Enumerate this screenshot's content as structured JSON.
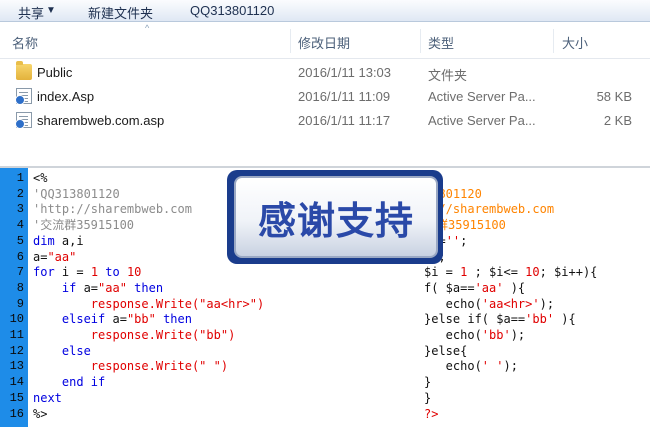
{
  "toolbar": {
    "share_label": "共享",
    "share_arrow": "▼",
    "new_folder_label": "新建文件夹",
    "qq_label": "QQ313801120"
  },
  "columns": {
    "sort_arrow": "^",
    "name": "名称",
    "date": "修改日期",
    "type": "类型",
    "size": "大小"
  },
  "files": [
    {
      "name": "Public",
      "date": "2016/1/11 13:03",
      "type": "文件夹",
      "size": "",
      "icon": "folder-icon"
    },
    {
      "name": "index.Asp",
      "date": "2016/1/11 11:09",
      "type": "Active Server Pa...",
      "size": "58 KB",
      "icon": "asp-file-icon"
    },
    {
      "name": "sharembweb.com.asp",
      "date": "2016/1/11 11:17",
      "type": "Active Server Pa...",
      "size": "2 KB",
      "icon": "asp-file-icon"
    }
  ],
  "asp_code": [
    {
      "n": "1",
      "segs": [
        [
          "<%",
          "c-black"
        ]
      ]
    },
    {
      "n": "2",
      "segs": [
        [
          "'QQ313801120",
          "c-gray"
        ]
      ]
    },
    {
      "n": "3",
      "segs": [
        [
          "'http://sharembweb.com",
          "c-gray"
        ]
      ]
    },
    {
      "n": "4",
      "segs": [
        [
          "'交流群35915100",
          "c-gray"
        ]
      ]
    },
    {
      "n": "5",
      "segs": [
        [
          "dim",
          "c-blue"
        ],
        [
          " a,i",
          "c-black"
        ]
      ]
    },
    {
      "n": "6",
      "segs": [
        [
          "a=",
          "c-black"
        ],
        [
          "\"aa\"",
          "c-red"
        ]
      ]
    },
    {
      "n": "7",
      "segs": [
        [
          "for",
          "c-blue"
        ],
        [
          " i = ",
          "c-black"
        ],
        [
          "1",
          "c-red"
        ],
        [
          " to ",
          "c-blue"
        ],
        [
          "10",
          "c-red"
        ]
      ]
    },
    {
      "n": "8",
      "segs": [
        [
          "    if",
          "c-blue"
        ],
        [
          " a=",
          "c-black"
        ],
        [
          "\"aa\"",
          "c-red"
        ],
        [
          " then",
          "c-blue"
        ]
      ]
    },
    {
      "n": "9",
      "segs": [
        [
          "        response.Write(",
          "c-red"
        ],
        [
          "\"aa<hr>\"",
          "c-red"
        ],
        [
          ")",
          "c-red"
        ]
      ]
    },
    {
      "n": "10",
      "segs": [
        [
          "    elseif",
          "c-blue"
        ],
        [
          " a=",
          "c-black"
        ],
        [
          "\"bb\"",
          "c-red"
        ],
        [
          " then",
          "c-blue"
        ]
      ]
    },
    {
      "n": "11",
      "segs": [
        [
          "        response.Write(",
          "c-red"
        ],
        [
          "\"bb\"",
          "c-red"
        ],
        [
          ")",
          "c-red"
        ]
      ]
    },
    {
      "n": "12",
      "segs": [
        [
          "    else",
          "c-blue"
        ]
      ]
    },
    {
      "n": "13",
      "segs": [
        [
          "        response.Write(",
          "c-red"
        ],
        [
          "\" \"",
          "c-red"
        ],
        [
          ")",
          "c-red"
        ]
      ]
    },
    {
      "n": "14",
      "segs": [
        [
          "    end if",
          "c-blue"
        ]
      ]
    },
    {
      "n": "15",
      "segs": [
        [
          "next",
          "c-blue"
        ]
      ]
    },
    {
      "n": "16",
      "segs": [
        [
          "%>",
          "c-black"
        ]
      ]
    }
  ],
  "php_code": [
    {
      "n": "2",
      "segs": [
        [
          "13801120",
          "c-orange"
        ]
      ]
    },
    {
      "n": "3",
      "segs": [
        [
          "p://sharembweb.com",
          "c-orange"
        ]
      ]
    },
    {
      "n": "4",
      "segs": [
        [
          "流群35915100",
          "c-orange"
        ]
      ]
    },
    {
      "n": "5",
      "segs": [
        [
          "$i=",
          "c-black"
        ],
        [
          "''",
          "c-red"
        ],
        [
          ";",
          "c-black"
        ]
      ]
    },
    {
      "n": "6",
      "segs": [
        [
          "a'",
          "c-red"
        ],
        [
          ";",
          "c-black"
        ]
      ]
    },
    {
      "n": "7",
      "segs": [
        [
          "$i = ",
          "c-black"
        ],
        [
          "1",
          "c-red"
        ],
        [
          " ; $i<= ",
          "c-black"
        ],
        [
          "10",
          "c-red"
        ],
        [
          "; $i++){",
          "c-black"
        ]
      ]
    },
    {
      "n": "8",
      "segs": [
        [
          "f( $a==",
          "c-black"
        ],
        [
          "'aa'",
          "c-red"
        ],
        [
          " ){",
          "c-black"
        ]
      ]
    },
    {
      "n": "9",
      "segs": [
        [
          "   echo(",
          "c-black"
        ],
        [
          "'aa<hr>'",
          "c-red"
        ],
        [
          ");",
          "c-black"
        ]
      ]
    },
    {
      "n": "10",
      "segs": [
        [
          "}else if( $a==",
          "c-black"
        ],
        [
          "'bb'",
          "c-red"
        ],
        [
          " ){",
          "c-black"
        ]
      ]
    },
    {
      "n": "11",
      "segs": [
        [
          "   echo(",
          "c-black"
        ],
        [
          "'bb'",
          "c-red"
        ],
        [
          ");",
          "c-black"
        ]
      ]
    },
    {
      "n": "12",
      "segs": [
        [
          "}else{",
          "c-black"
        ]
      ]
    },
    {
      "n": "13",
      "segs": [
        [
          "   echo(",
          "c-black"
        ],
        [
          "' '",
          "c-red"
        ],
        [
          ");",
          "c-black"
        ]
      ]
    },
    {
      "n": "14",
      "segs": [
        [
          "}",
          "c-black"
        ]
      ]
    },
    {
      "n": "15",
      "segs": [
        [
          "}",
          "c-black"
        ]
      ]
    },
    {
      "n": "16",
      "segs": [
        [
          "?>",
          "c-red"
        ]
      ]
    }
  ],
  "banner_text": "感谢支持",
  "colors": {
    "gutter": "#1e8ce8",
    "keyword": "#0000e0",
    "string": "#e00000",
    "comment": "#8c8c8c",
    "banner_text": "#2a49a8"
  }
}
